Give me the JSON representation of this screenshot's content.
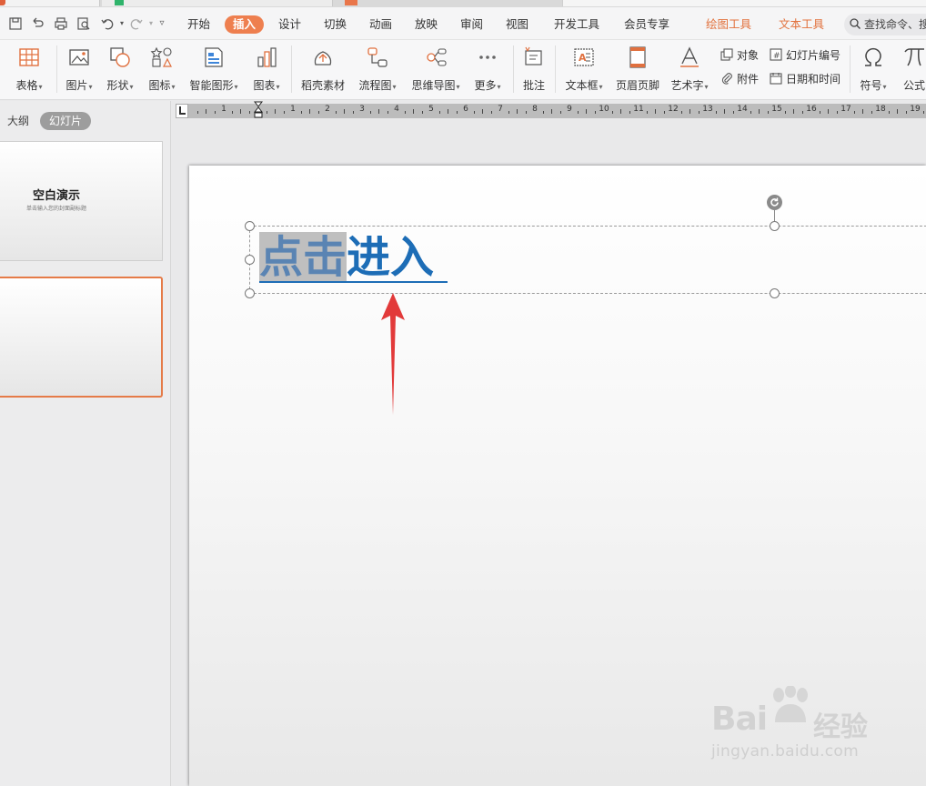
{
  "quick_access": [
    "save-icon",
    "undo-history-icon",
    "print-icon",
    "print-preview-icon",
    "undo-icon",
    "redo-icon",
    "customize-icon"
  ],
  "menu": {
    "items": [
      "开始",
      "插入",
      "设计",
      "切换",
      "动画",
      "放映",
      "审阅",
      "视图",
      "开发工具",
      "会员专享"
    ],
    "active": "插入",
    "context_tabs": [
      "绘图工具",
      "文本工具"
    ],
    "search_placeholder": "查找命令、搜"
  },
  "ribbon": {
    "table": "表格",
    "picture": "图片",
    "shape": "形状",
    "icons": "图标",
    "smartart": "智能图形",
    "chart": "图表",
    "docer": "稻壳素材",
    "flowchart": "流程图",
    "mindmap": "思维导图",
    "more": "更多",
    "comment": "批注",
    "textbox": "文本框",
    "header_footer": "页眉页脚",
    "wordart": "艺术字",
    "object": "对象",
    "attachment": "附件",
    "slide_number": "幻灯片编号",
    "datetime": "日期和时间",
    "symbol": "符号",
    "formula": "公式"
  },
  "left_panel": {
    "tab_outline": "大纲",
    "tab_slides": "幻灯片",
    "slides": [
      {
        "title": "空白演示",
        "subtitle": "单击输入您的封面副标题"
      },
      {
        "title": "",
        "subtitle": ""
      }
    ]
  },
  "ruler": {
    "left_numbers": [
      "1"
    ],
    "right_numbers": [
      "1",
      "2",
      "3",
      "4",
      "5",
      "6",
      "7",
      "8",
      "9",
      "10",
      "11",
      "12",
      "13",
      "14",
      "15",
      "16",
      "17",
      "18",
      "19"
    ]
  },
  "slide": {
    "title_selected": "点击",
    "title_rest": "进入"
  },
  "watermark": {
    "brand": "Bai",
    "brand_suffix": "经验",
    "url": "jingyan.baidu.com"
  },
  "colors": {
    "accent": "#ee7f4f",
    "title_text": "#1d6db6",
    "annotation_arrow": "#e23a3a"
  }
}
